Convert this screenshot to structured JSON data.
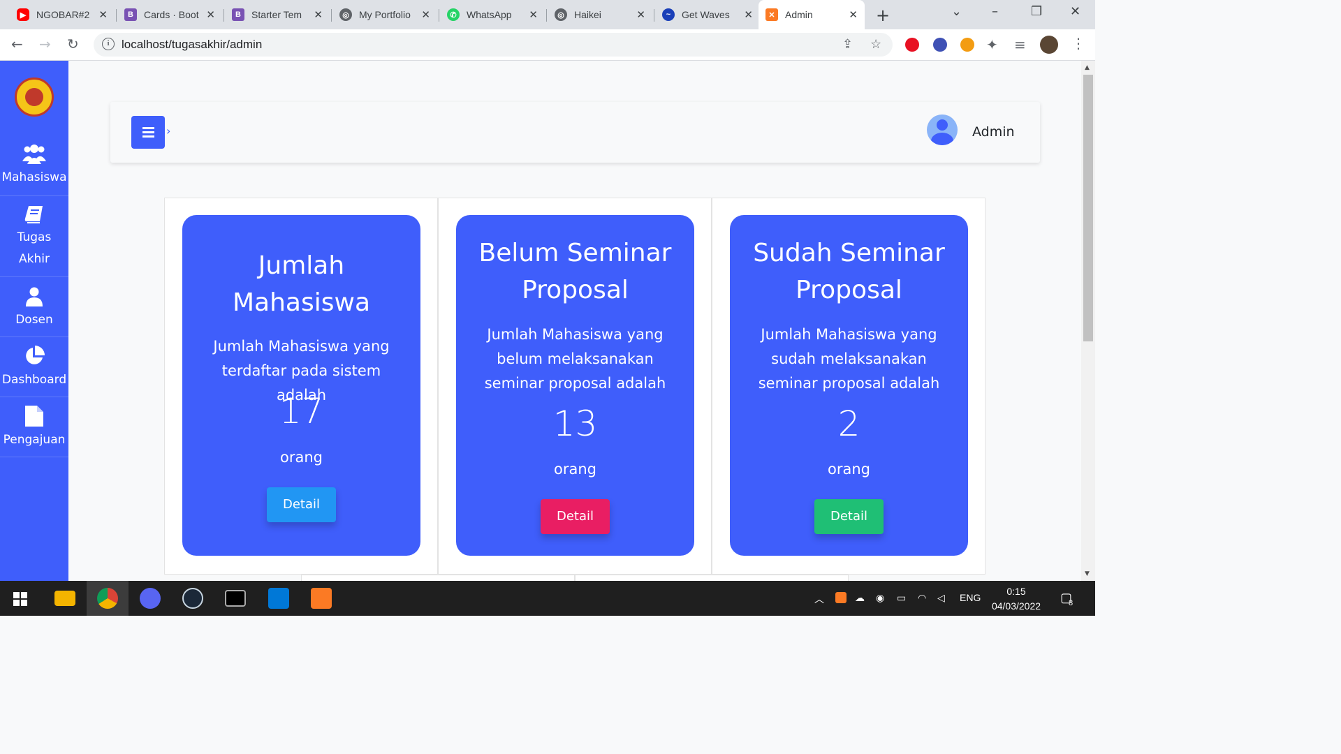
{
  "browser": {
    "tabs": [
      {
        "title": "NGOBAR#2",
        "icon": "youtube-icon",
        "color": "#ff0000"
      },
      {
        "title": "Cards · Boot",
        "icon": "bootstrap-icon",
        "color": "#7952b3"
      },
      {
        "title": "Starter Tem",
        "icon": "bootstrap-icon",
        "color": "#7952b3"
      },
      {
        "title": "My Portfolio",
        "icon": "globe-icon",
        "color": "#5f6368"
      },
      {
        "title": "WhatsApp",
        "icon": "whatsapp-icon",
        "color": "#25d366"
      },
      {
        "title": "Haikei",
        "icon": "globe-icon",
        "color": "#5f6368"
      },
      {
        "title": "Get Waves",
        "icon": "waves-icon",
        "color": "#1a3fb8"
      },
      {
        "title": "Admin",
        "icon": "xampp-icon",
        "color": "#fb7a24"
      }
    ],
    "url": "localhost/tugasakhir/admin"
  },
  "sidebar": {
    "items": [
      {
        "label": "Mahasiswa",
        "icon": "users-icon"
      },
      {
        "label": "Tugas Akhir",
        "icon": "book-icon"
      },
      {
        "label": "Dosen",
        "icon": "user-icon"
      },
      {
        "label": "Dashboard",
        "icon": "pie-chart-icon"
      },
      {
        "label": "Pengajuan",
        "icon": "file-icon"
      }
    ]
  },
  "header": {
    "user_name": "Admin"
  },
  "cards": [
    {
      "title_line1": "Jumlah",
      "title_line2": "Mahasiswa",
      "desc_line1": "Jumlah Mahasiswa yang",
      "desc_line2": "terdaftar pada sistem adalah",
      "desc_line3": "",
      "count": "17",
      "unit": "orang",
      "button": "Detail",
      "button_color": "#2196f3"
    },
    {
      "title_line1": "Belum Seminar",
      "title_line2": "Proposal",
      "desc_line1": "Jumlah Mahasiswa yang",
      "desc_line2": "belum melaksanakan",
      "desc_line3": "seminar proposal adalah",
      "count": "13",
      "unit": "orang",
      "button": "Detail",
      "button_color": "#e91e63"
    },
    {
      "title_line1": "Sudah Seminar",
      "title_line2": "Proposal",
      "desc_line1": "Jumlah Mahasiswa yang",
      "desc_line2": "sudah melaksanakan",
      "desc_line3": "seminar proposal adalah",
      "count": "2",
      "unit": "orang",
      "button": "Detail",
      "button_color": "#1fbf75"
    }
  ],
  "taskbar": {
    "language": "ENG",
    "time": "0:15",
    "date": "04/03/2022",
    "notifications": "8"
  },
  "colors": {
    "primary": "#3f5efb"
  }
}
